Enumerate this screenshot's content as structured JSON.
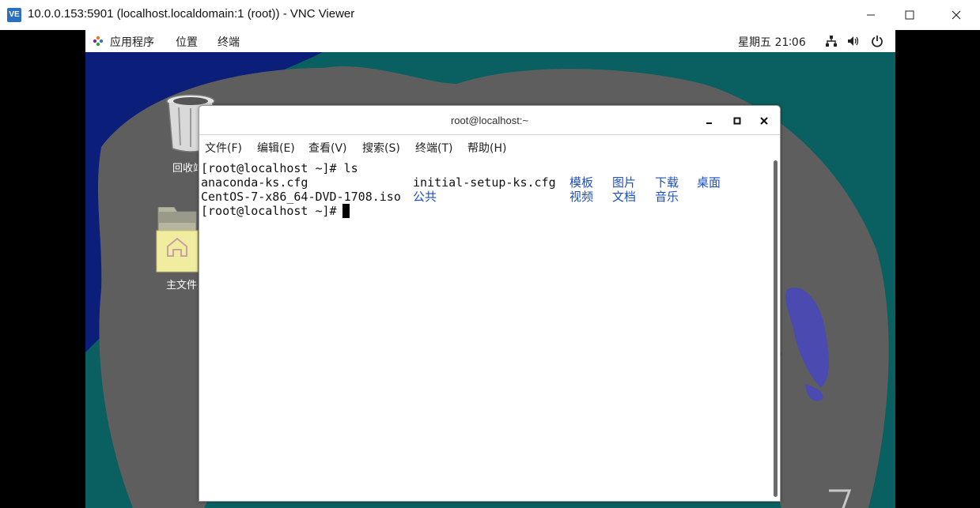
{
  "vnc": {
    "logo_text": "VE",
    "title": "10.0.0.153:5901 (localhost.localdomain:1 (root)) - VNC Viewer",
    "controls": [
      "minimize-icon",
      "maximize-icon",
      "close-icon"
    ]
  },
  "topbar": {
    "apps_icon": "gnome-apps-icon",
    "menu": [
      "应用程序",
      "位置",
      "终端"
    ],
    "clock": "星期五 21∶06",
    "tray": [
      "network-icon",
      "volume-icon",
      "power-icon"
    ]
  },
  "desktop": {
    "icons": [
      {
        "icon": "trash-icon",
        "label": "回收站"
      },
      {
        "icon": "home-folder-icon",
        "label": "主文件夹"
      }
    ]
  },
  "terminal": {
    "title": "root@localhost:~",
    "controls": [
      "minimize-icon",
      "maximize-icon",
      "close-icon"
    ],
    "menu": [
      "文件(F)",
      "编辑(E)",
      "查看(V)",
      "搜索(S)",
      "终端(T)",
      "帮助(H)"
    ],
    "lines": {
      "prompt1": "[root@localhost ~]# ls",
      "file1": "anaconda-ks.cfg",
      "file2": "initial-setup-ks.cfg",
      "dir1": "模板",
      "dir2": "图片",
      "dir3": "下载",
      "dir4": "桌面",
      "file3": "CentOS-7-x86_64-DVD-1708.iso",
      "dir5": "公共",
      "dir6": "视频",
      "dir7": "文档",
      "dir8": "音乐",
      "prompt2": "[root@localhost ~]# "
    }
  },
  "colors": {
    "desktop_teal": "#0a6060",
    "desktop_gray": "#5e5e5e",
    "desktop_navy": "#0b1f7a",
    "dir_blue": "#1f4fbf"
  }
}
